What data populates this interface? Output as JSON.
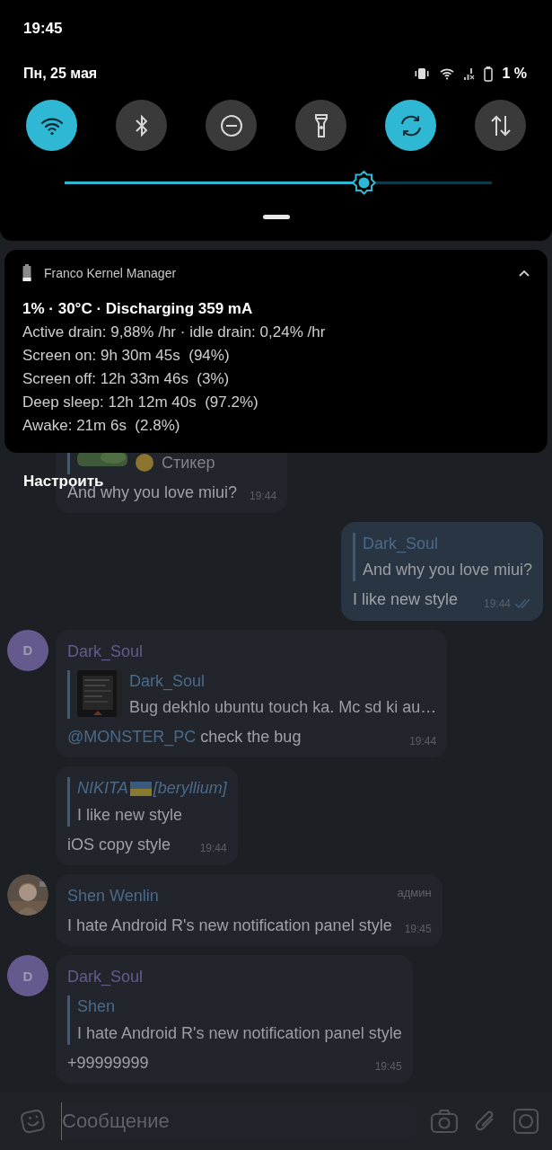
{
  "status_bar": {
    "time": "19:45"
  },
  "quick_settings": {
    "date": "Пн, 25 мая",
    "battery": "1 %",
    "tiles": [
      {
        "kind": "wifi",
        "on": true
      },
      {
        "kind": "bluetooth",
        "on": false
      },
      {
        "kind": "dnd",
        "on": false
      },
      {
        "kind": "flashlight",
        "on": false
      },
      {
        "kind": "sync",
        "on": true
      },
      {
        "kind": "data",
        "on": false
      }
    ],
    "brightness": {
      "level": 0.7
    }
  },
  "notification": {
    "app": "Franco Kernel Manager",
    "expanded": true,
    "title": "1% · 30°C · Discharging 359 mA",
    "lines": [
      "Active drain: 9,88% /hr · idle drain: 0,24% /hr",
      "Screen on: 9h 30m 45s  (94%)",
      "Screen off: 12h 33m 46s  (3%)",
      "Deep sleep: 12h 12m 40s  (97.2%)",
      "Awake: 21m 6s  (2.8%)"
    ]
  },
  "notification_action": "Настроить",
  "chat": {
    "messages": [
      {
        "outgoing": false,
        "reply": {
          "kind": "sticker",
          "text": "Стикер"
        },
        "text": "And why you love miui?",
        "time": "19:44"
      },
      {
        "outgoing": true,
        "read": true,
        "reply": {
          "kind": "text",
          "name_parts": [
            "Dark_Soul"
          ],
          "italic": false,
          "text": "And why you love miui?"
        },
        "text": "I like new style",
        "time": "19:44"
      },
      {
        "outgoing": false,
        "avatar": {
          "kind": "letter",
          "letter": "D",
          "color": "#645a8e"
        },
        "sender": "Dark_Soul",
        "reply": {
          "kind": "picture",
          "name_parts": [
            "Dark_Soul"
          ],
          "italic": false,
          "text": "Bug dekhlo ubuntu touch ka. Mc sd ki au…"
        },
        "mention": "@MONSTER_PC",
        "text": "check the bug",
        "time": "19:44"
      },
      {
        "outgoing": false,
        "reply": {
          "kind": "text",
          "name_parts": [
            "NIKITA",
            "[beryllium]"
          ],
          "italic": true,
          "text": "I like new style"
        },
        "text": "iOS copy style",
        "time": "19:44"
      },
      {
        "outgoing": false,
        "sender": "Shen Wenlin",
        "badge": "админ",
        "text": "I hate Android R's new notification panel style",
        "time": "19:45"
      },
      {
        "outgoing": false,
        "avatar": {
          "kind": "letter",
          "letter": "D",
          "color": "#645a8e"
        },
        "sender": "Dark_Soul",
        "reply": {
          "kind": "text",
          "name_parts": [
            "Shen"
          ],
          "italic": false,
          "text": "I hate Android R's new notification panel style"
        },
        "text": "+99999999",
        "time": "19:45"
      }
    ]
  },
  "composer": {
    "placeholder": "Сообщение"
  }
}
